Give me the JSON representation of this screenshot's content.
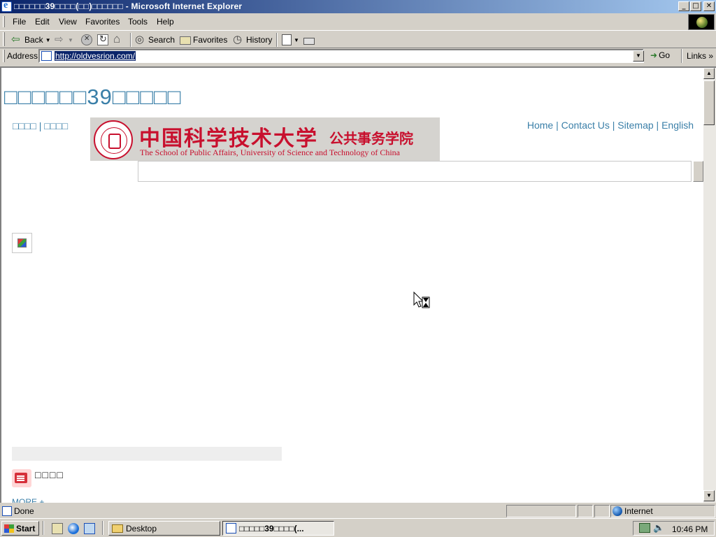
{
  "window": {
    "title": "□□□□□□39□□□□(□□)□□□□□□ - Microsoft Internet Explorer",
    "caption_buttons": [
      "_",
      "□",
      "✕"
    ]
  },
  "menu": [
    "File",
    "Edit",
    "View",
    "Favorites",
    "Tools",
    "Help"
  ],
  "toolbar": {
    "back": "Back",
    "search": "Search",
    "favorites": "Favorites",
    "history": "History"
  },
  "address": {
    "label": "Address",
    "url": "http://oldvesrion.com/",
    "go": "Go",
    "links": "Links"
  },
  "page": {
    "site_title": "□□□□□□39□□□□□",
    "left_links": [
      "□□□□",
      "□□□□"
    ],
    "logo": {
      "cn_name": "中国科学技术大学",
      "cn_school": "公共事务学院",
      "en_name": "The School of Public Affairs, University of Science and Technology of China"
    },
    "right_links": [
      "Home",
      "Contact Us",
      "Sitemap",
      "English"
    ],
    "news_title": "□□□□",
    "more_link": "MORE +"
  },
  "status": {
    "text": "Done",
    "zone": "Internet"
  },
  "taskbar": {
    "start": "Start",
    "tasks": [
      "Desktop",
      "□□□□□39□□□□(..."
    ],
    "clock": "10:46 PM"
  }
}
